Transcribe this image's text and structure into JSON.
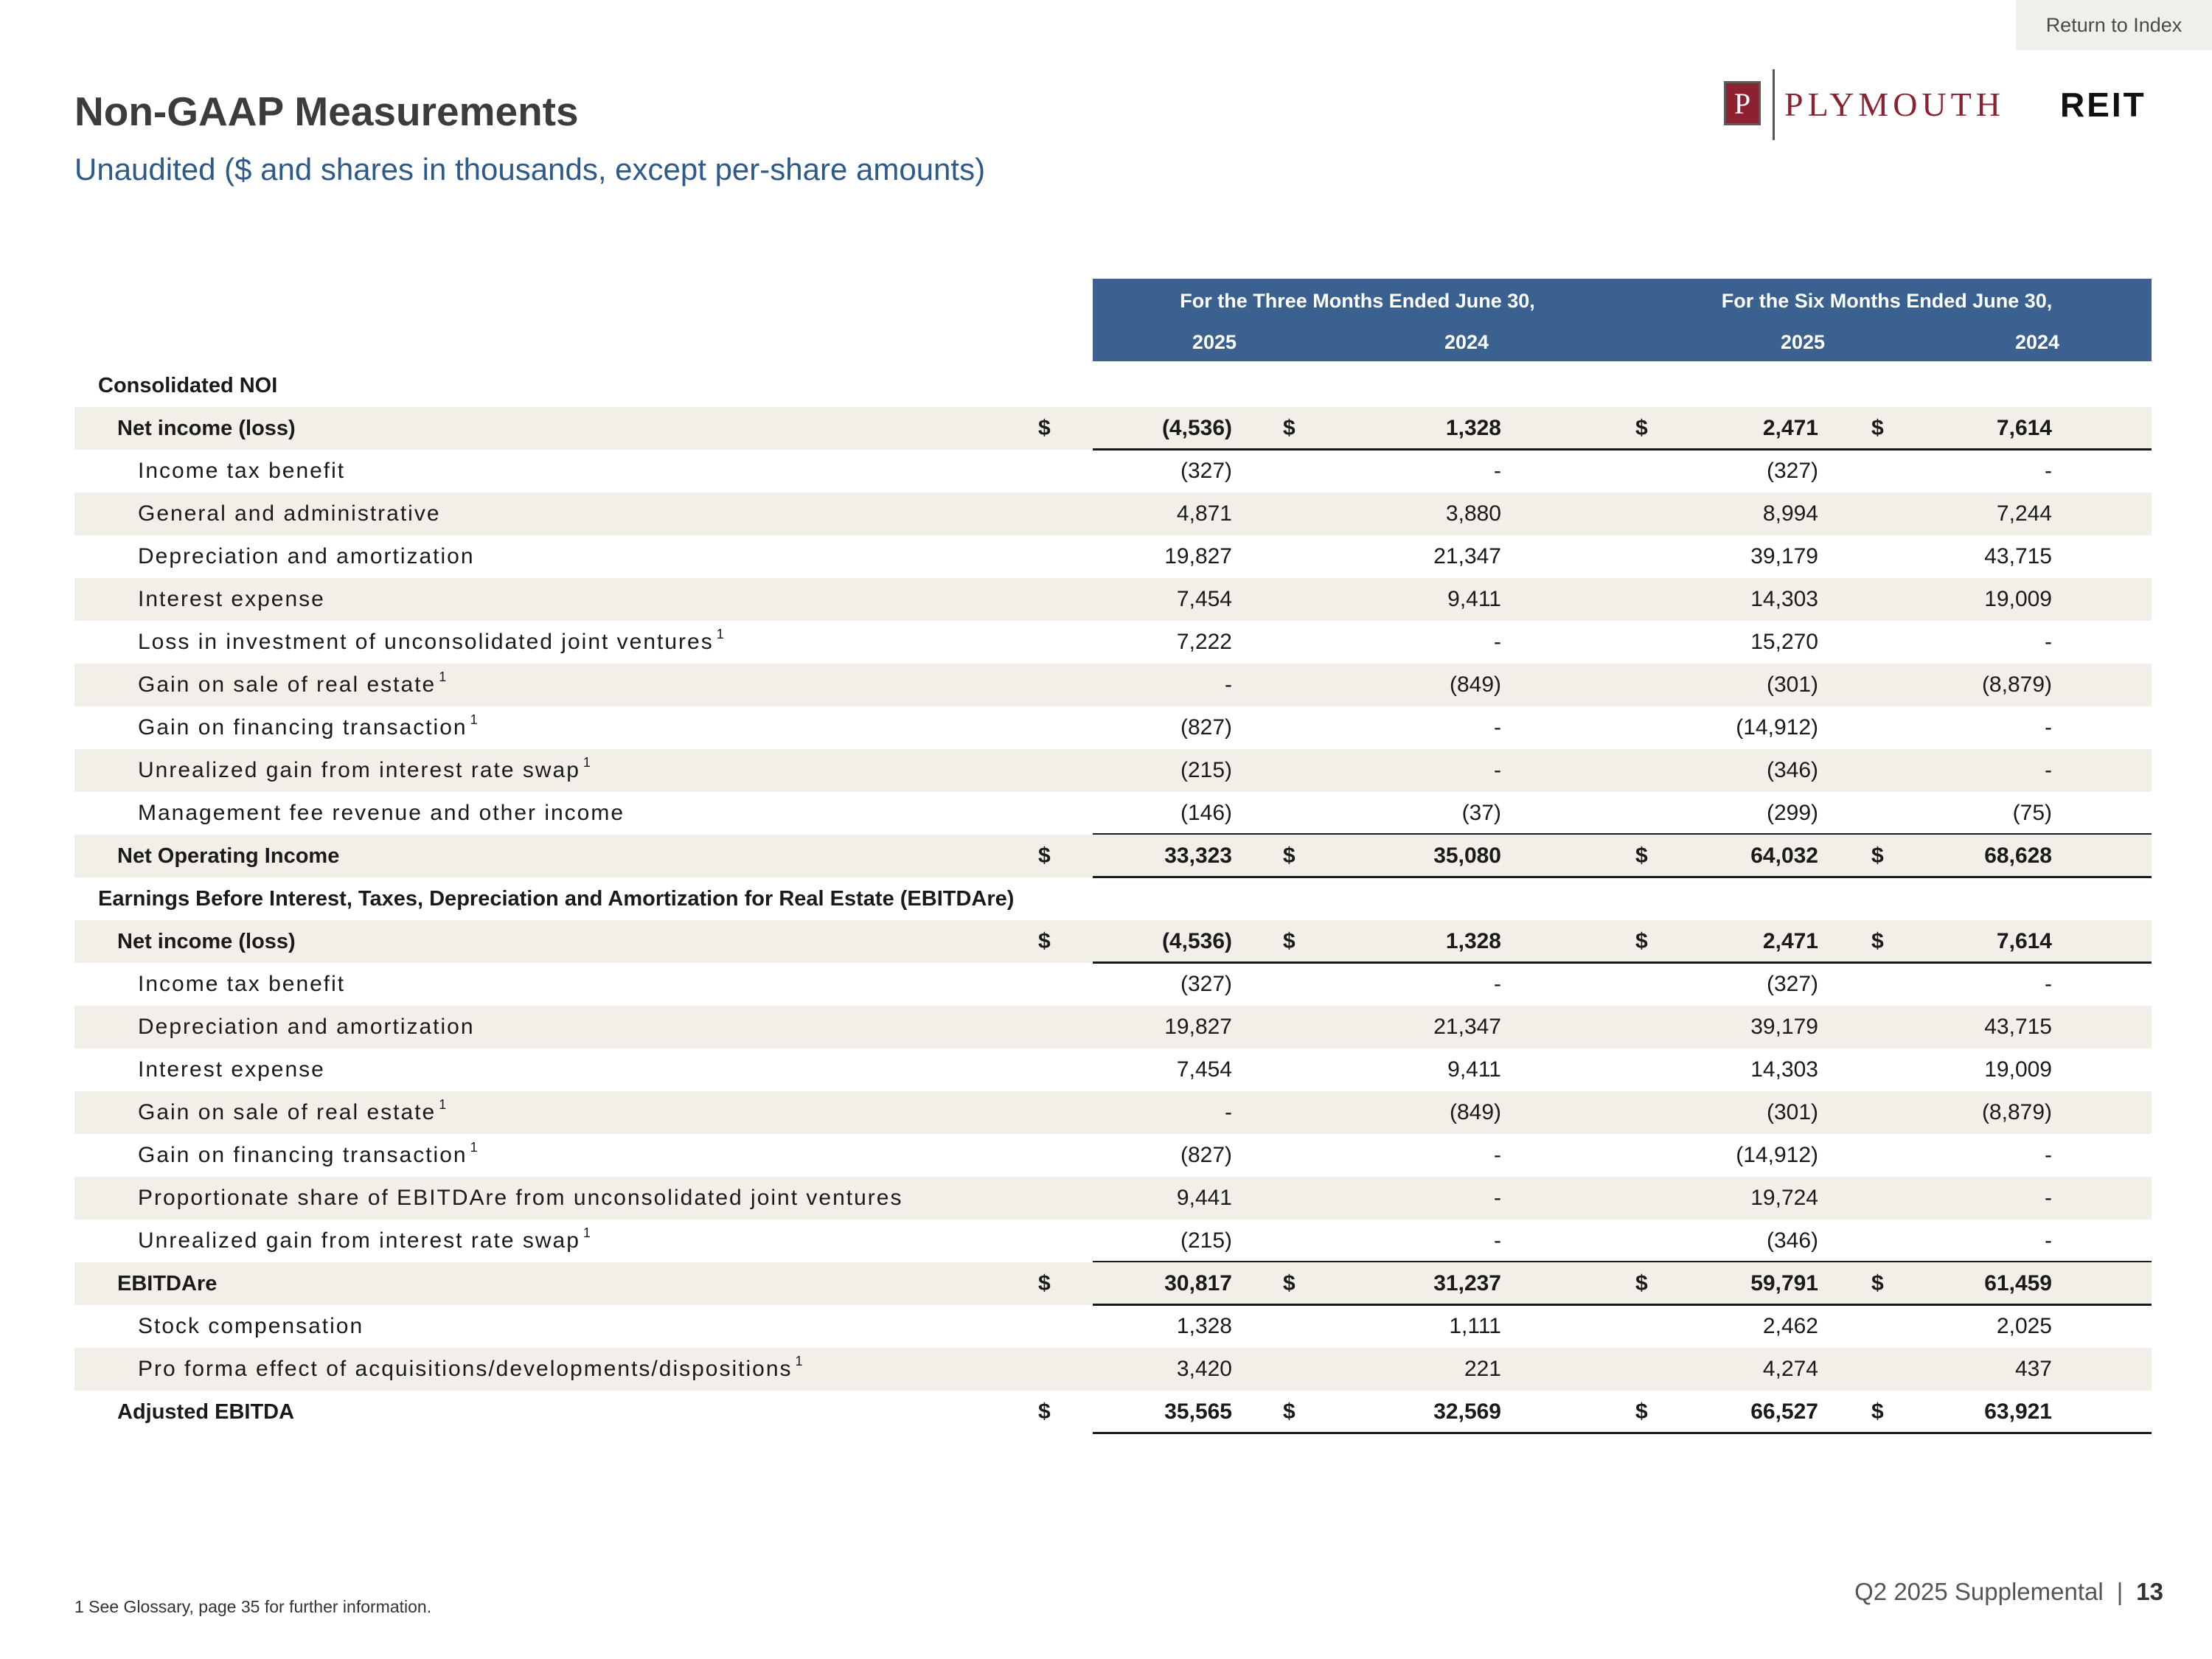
{
  "nav": {
    "return_label": "Return to Index"
  },
  "header": {
    "title": "Non-GAAP Measurements",
    "subtitle": "Unaudited ($ and shares in thousands, except per-share amounts)"
  },
  "logo": {
    "box_letter": "P",
    "word": "PLYMOUTH",
    "suffix": "REIT"
  },
  "table": {
    "period_headers": [
      "For the Three Months Ended June 30,",
      "For the Six Months Ended June 30,"
    ],
    "years": [
      "2025",
      "2024",
      "2025",
      "2024"
    ],
    "rows": [
      {
        "label": "Consolidated NOI",
        "level": 0,
        "shaded": false,
        "section": true,
        "values": []
      },
      {
        "label": "Net income (loss)",
        "level": 1,
        "shaded": true,
        "bold": true,
        "dollar": true,
        "rule": true,
        "values": [
          "(4,536)",
          "1,328",
          "2,471",
          "7,614"
        ]
      },
      {
        "label": "Income tax benefit",
        "level": 2,
        "shaded": false,
        "values": [
          "(327)",
          "-",
          "(327)",
          "-"
        ]
      },
      {
        "label": "General and administrative",
        "level": 2,
        "shaded": true,
        "values": [
          "4,871",
          "3,880",
          "8,994",
          "7,244"
        ]
      },
      {
        "label": "Depreciation and amortization",
        "level": 2,
        "shaded": false,
        "values": [
          "19,827",
          "21,347",
          "39,179",
          "43,715"
        ]
      },
      {
        "label": "Interest expense",
        "level": 2,
        "shaded": true,
        "values": [
          "7,454",
          "9,411",
          "14,303",
          "19,009"
        ]
      },
      {
        "label": "Loss in investment of unconsolidated joint ventures",
        "sup": "1",
        "level": 2,
        "shaded": false,
        "values": [
          "7,222",
          "-",
          "15,270",
          "-"
        ]
      },
      {
        "label": "Gain on sale of real estate",
        "sup": "1",
        "level": 2,
        "shaded": true,
        "values": [
          "-",
          "(849)",
          "(301)",
          "(8,879)"
        ]
      },
      {
        "label": "Gain on financing transaction",
        "sup": "1",
        "level": 2,
        "shaded": false,
        "values": [
          "(827)",
          "-",
          "(14,912)",
          "-"
        ]
      },
      {
        "label": "Unrealized gain from interest rate swap",
        "sup": "1",
        "level": 2,
        "shaded": true,
        "values": [
          "(215)",
          "-",
          "(346)",
          "-"
        ]
      },
      {
        "label": "Management fee revenue and other income",
        "level": 2,
        "shaded": false,
        "rule": true,
        "values": [
          "(146)",
          "(37)",
          "(299)",
          "(75)"
        ]
      },
      {
        "label": "Net Operating Income",
        "level": 1,
        "shaded": true,
        "bold": true,
        "dollar": true,
        "rule": true,
        "values": [
          "33,323",
          "35,080",
          "64,032",
          "68,628"
        ]
      },
      {
        "label": "Earnings Before Interest, Taxes, Depreciation and Amortization for Real Estate (EBITDAre)",
        "level": 0,
        "shaded": false,
        "section": true,
        "values": []
      },
      {
        "label": "Net income (loss)",
        "level": 1,
        "shaded": true,
        "bold": true,
        "dollar": true,
        "rule": true,
        "values": [
          "(4,536)",
          "1,328",
          "2,471",
          "7,614"
        ]
      },
      {
        "label": "Income tax benefit",
        "level": 2,
        "shaded": false,
        "values": [
          "(327)",
          "-",
          "(327)",
          "-"
        ]
      },
      {
        "label": "Depreciation and amortization",
        "level": 2,
        "shaded": true,
        "values": [
          "19,827",
          "21,347",
          "39,179",
          "43,715"
        ]
      },
      {
        "label": "Interest expense",
        "level": 2,
        "shaded": false,
        "values": [
          "7,454",
          "9,411",
          "14,303",
          "19,009"
        ]
      },
      {
        "label": "Gain on sale of real estate",
        "sup": "1",
        "level": 2,
        "shaded": true,
        "values": [
          "-",
          "(849)",
          "(301)",
          "(8,879)"
        ]
      },
      {
        "label": "Gain on financing transaction",
        "sup": "1",
        "level": 2,
        "shaded": false,
        "values": [
          "(827)",
          "-",
          "(14,912)",
          "-"
        ]
      },
      {
        "label": "Proportionate share of EBITDAre from unconsolidated joint ventures",
        "level": 2,
        "shaded": true,
        "values": [
          "9,441",
          "-",
          "19,724",
          "-"
        ]
      },
      {
        "label": "Unrealized gain from interest rate swap",
        "sup": "1",
        "level": 2,
        "shaded": false,
        "rule": true,
        "values": [
          "(215)",
          "-",
          "(346)",
          "-"
        ]
      },
      {
        "label": "EBITDAre",
        "level": 1,
        "shaded": true,
        "bold": true,
        "dollar": true,
        "rule": true,
        "values": [
          "30,817",
          "31,237",
          "59,791",
          "61,459"
        ]
      },
      {
        "label": "Stock compensation",
        "level": 2,
        "shaded": false,
        "values": [
          "1,328",
          "1,111",
          "2,462",
          "2,025"
        ]
      },
      {
        "label": "Pro forma effect of acquisitions/developments/dispositions",
        "sup": "1",
        "level": 2,
        "shaded": true,
        "values": [
          "3,420",
          "221",
          "4,274",
          "437"
        ]
      },
      {
        "label": "Adjusted EBITDA",
        "level": 1,
        "shaded": false,
        "bold": true,
        "dollar": true,
        "rule": true,
        "values": [
          "35,565",
          "32,569",
          "66,527",
          "63,921"
        ]
      }
    ]
  },
  "footnote": "1  See Glossary, page 35 for further information.",
  "footer": {
    "label": "Q2 2025 Supplemental",
    "separator": "|",
    "page": "13"
  }
}
